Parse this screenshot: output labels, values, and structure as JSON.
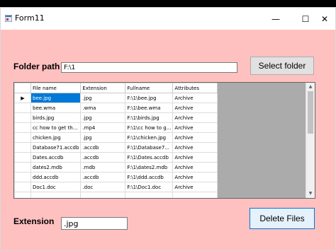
{
  "window": {
    "title": "Form11",
    "minimize_glyph": "—",
    "maximize_glyph": "☐",
    "close_glyph": "✕"
  },
  "folder": {
    "label": "Folder path",
    "value": "F:\\1",
    "select_button": "Select folder"
  },
  "grid": {
    "columns": [
      "File name",
      "Extension",
      "Fullname",
      "Attributes"
    ],
    "rows": [
      {
        "name": "bee.jpg",
        "ext": ".jpg",
        "full": "F:\\1\\bee.jpg",
        "attr": "Archive"
      },
      {
        "name": "bee.wma",
        "ext": ".wma",
        "full": "F:\\1\\bee.wma",
        "attr": "Archive"
      },
      {
        "name": "birds.jpg",
        "ext": ".jpg",
        "full": "F:\\1\\birds.jpg",
        "attr": "Archive"
      },
      {
        "name": "cc how to get th...",
        "ext": ".mp4",
        "full": "F:\\1\\cc how to g...",
        "attr": "Archive"
      },
      {
        "name": "chicken.jpg",
        "ext": ".jpg",
        "full": "F:\\1\\chicken.jpg",
        "attr": "Archive"
      },
      {
        "name": "Database71.accdb",
        "ext": ".accdb",
        "full": "F:\\1\\Database7...",
        "attr": "Archive"
      },
      {
        "name": "Dates.accdb",
        "ext": ".accdb",
        "full": "F:\\1\\Dates.accdb",
        "attr": "Archive"
      },
      {
        "name": "dates2.mdb",
        "ext": ".mdb",
        "full": "F:\\1\\dates2.mdb",
        "attr": "Archive"
      },
      {
        "name": "ddd.accdb",
        "ext": ".accdb",
        "full": "F:\\1\\ddd.accdb",
        "attr": "Archive"
      },
      {
        "name": "Doc1.doc",
        "ext": ".doc",
        "full": "F:\\1\\Doc1.doc",
        "attr": "Archive"
      },
      {
        "name": "",
        "ext": "",
        "full": "",
        "attr": ""
      }
    ],
    "current_row_marker": "▶"
  },
  "extension": {
    "label": "Extension",
    "value": ".jpg",
    "delete_button": "Delete Files"
  },
  "colors": {
    "form_background": "#ffc0c0",
    "selection": "#0078d7",
    "grid_background": "#ababab"
  }
}
